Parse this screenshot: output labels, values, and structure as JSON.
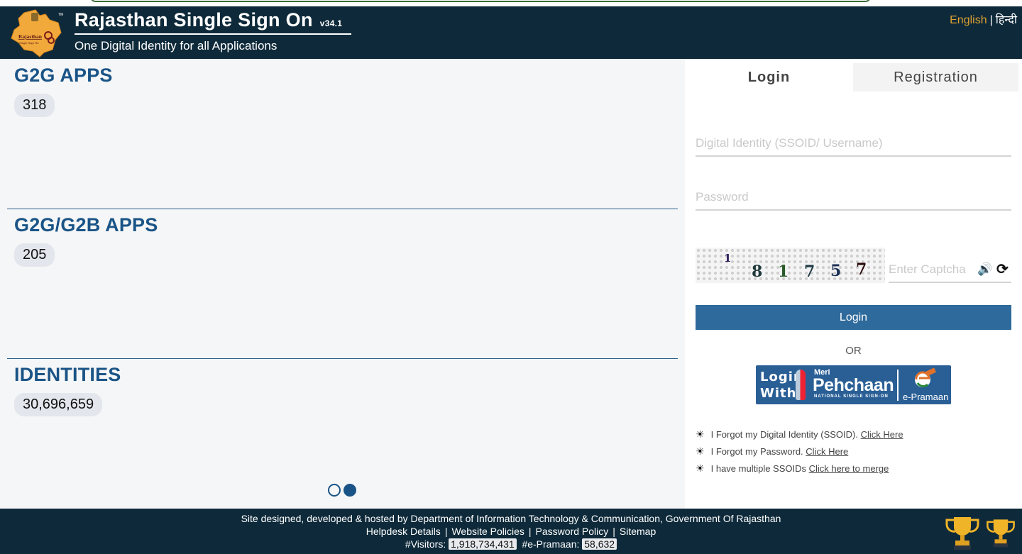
{
  "header": {
    "logo_alt": "Rajasthan Single Sign On",
    "title": "Rajasthan Single Sign On",
    "version": "v34.1",
    "subtitle": "One Digital Identity for all Applications",
    "lang_english": "English",
    "lang_separator": "|",
    "lang_hindi": "हिन्दी"
  },
  "stats": [
    {
      "heading": "G2G APPS",
      "count": "318"
    },
    {
      "heading": "G2G/G2B APPS",
      "count": "205"
    },
    {
      "heading": "IDENTITIES",
      "count": "30,696,659"
    }
  ],
  "carousel": {
    "slides": 2,
    "active_index": 1
  },
  "login_panel": {
    "tabs": [
      {
        "label": "Login",
        "active": true
      },
      {
        "label": "Registration",
        "active": false
      }
    ],
    "ssoid_placeholder": "Digital Identity (SSOID/ Username)",
    "password_placeholder": "Password",
    "captcha_chars": [
      "1",
      "8",
      "1",
      "7",
      "5",
      "7"
    ],
    "captcha_placeholder": "Enter Captcha",
    "speaker_icon": "🔊",
    "refresh_icon": "⟳",
    "login_button": "Login",
    "or_text": "OR",
    "epramaan": {
      "login_with_1": "Login",
      "login_with_2": "With",
      "meri": "Meri",
      "pehchaan": "Pehchaan",
      "national": "NATIONAL SINGLE SIGN-ON",
      "e_pramaan": "e-Pramaan"
    },
    "help_links": [
      {
        "text": "I Forgot my Digital Identity (SSOID).",
        "link": "Click Here"
      },
      {
        "text": "I Forgot my Password.",
        "link": "Click Here"
      },
      {
        "text": "I have multiple SSOIDs",
        "link": "Click here to merge"
      }
    ],
    "bullet_icon": "☀"
  },
  "footer": {
    "line1": "Site designed, developed & hosted by Department of Information Technology & Communication, Government Of Rajasthan",
    "links": [
      "Helpdesk Details",
      "Website Policies",
      "Password Policy",
      "Sitemap"
    ],
    "link_separator": "|",
    "visitors_label": "#Visitors:",
    "visitors_count": "1,918,734,431",
    "epramaan_label": "#e-Pramaan:",
    "epramaan_count": "58,632"
  }
}
